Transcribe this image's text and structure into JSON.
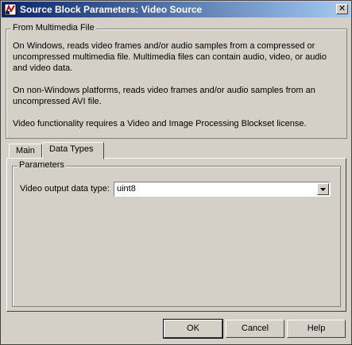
{
  "window": {
    "title": "Source Block Parameters: Video Source"
  },
  "description": {
    "group_title": "From Multimedia File",
    "para1": [
      "On Windows, reads video frames and/or audio samples from a compressed or",
      "uncompressed multimedia file. Multimedia files can contain audio, video, or audio",
      "and video data."
    ],
    "para2": [
      "On non-Windows platforms, reads video frames and/or audio samples from an",
      "uncompressed AVI file."
    ],
    "para3": "Video functionality requires a Video and Image Processing Blockset license."
  },
  "tabs": [
    {
      "label": "Main",
      "active": false
    },
    {
      "label": "Data Types",
      "active": true
    }
  ],
  "parameters": {
    "group_title": "Parameters",
    "video_output_label": "Video output data type:",
    "video_output_value": "uint8"
  },
  "buttons": {
    "ok": "OK",
    "cancel": "Cancel",
    "help": "Help"
  },
  "colors": {
    "titlebar_start": "#0a246a",
    "titlebar_end": "#a6caf0",
    "face": "#d4d0c8"
  },
  "icons": {
    "app": "simulink-block-icon",
    "close": "close-icon",
    "dropdown": "chevron-down-icon"
  }
}
